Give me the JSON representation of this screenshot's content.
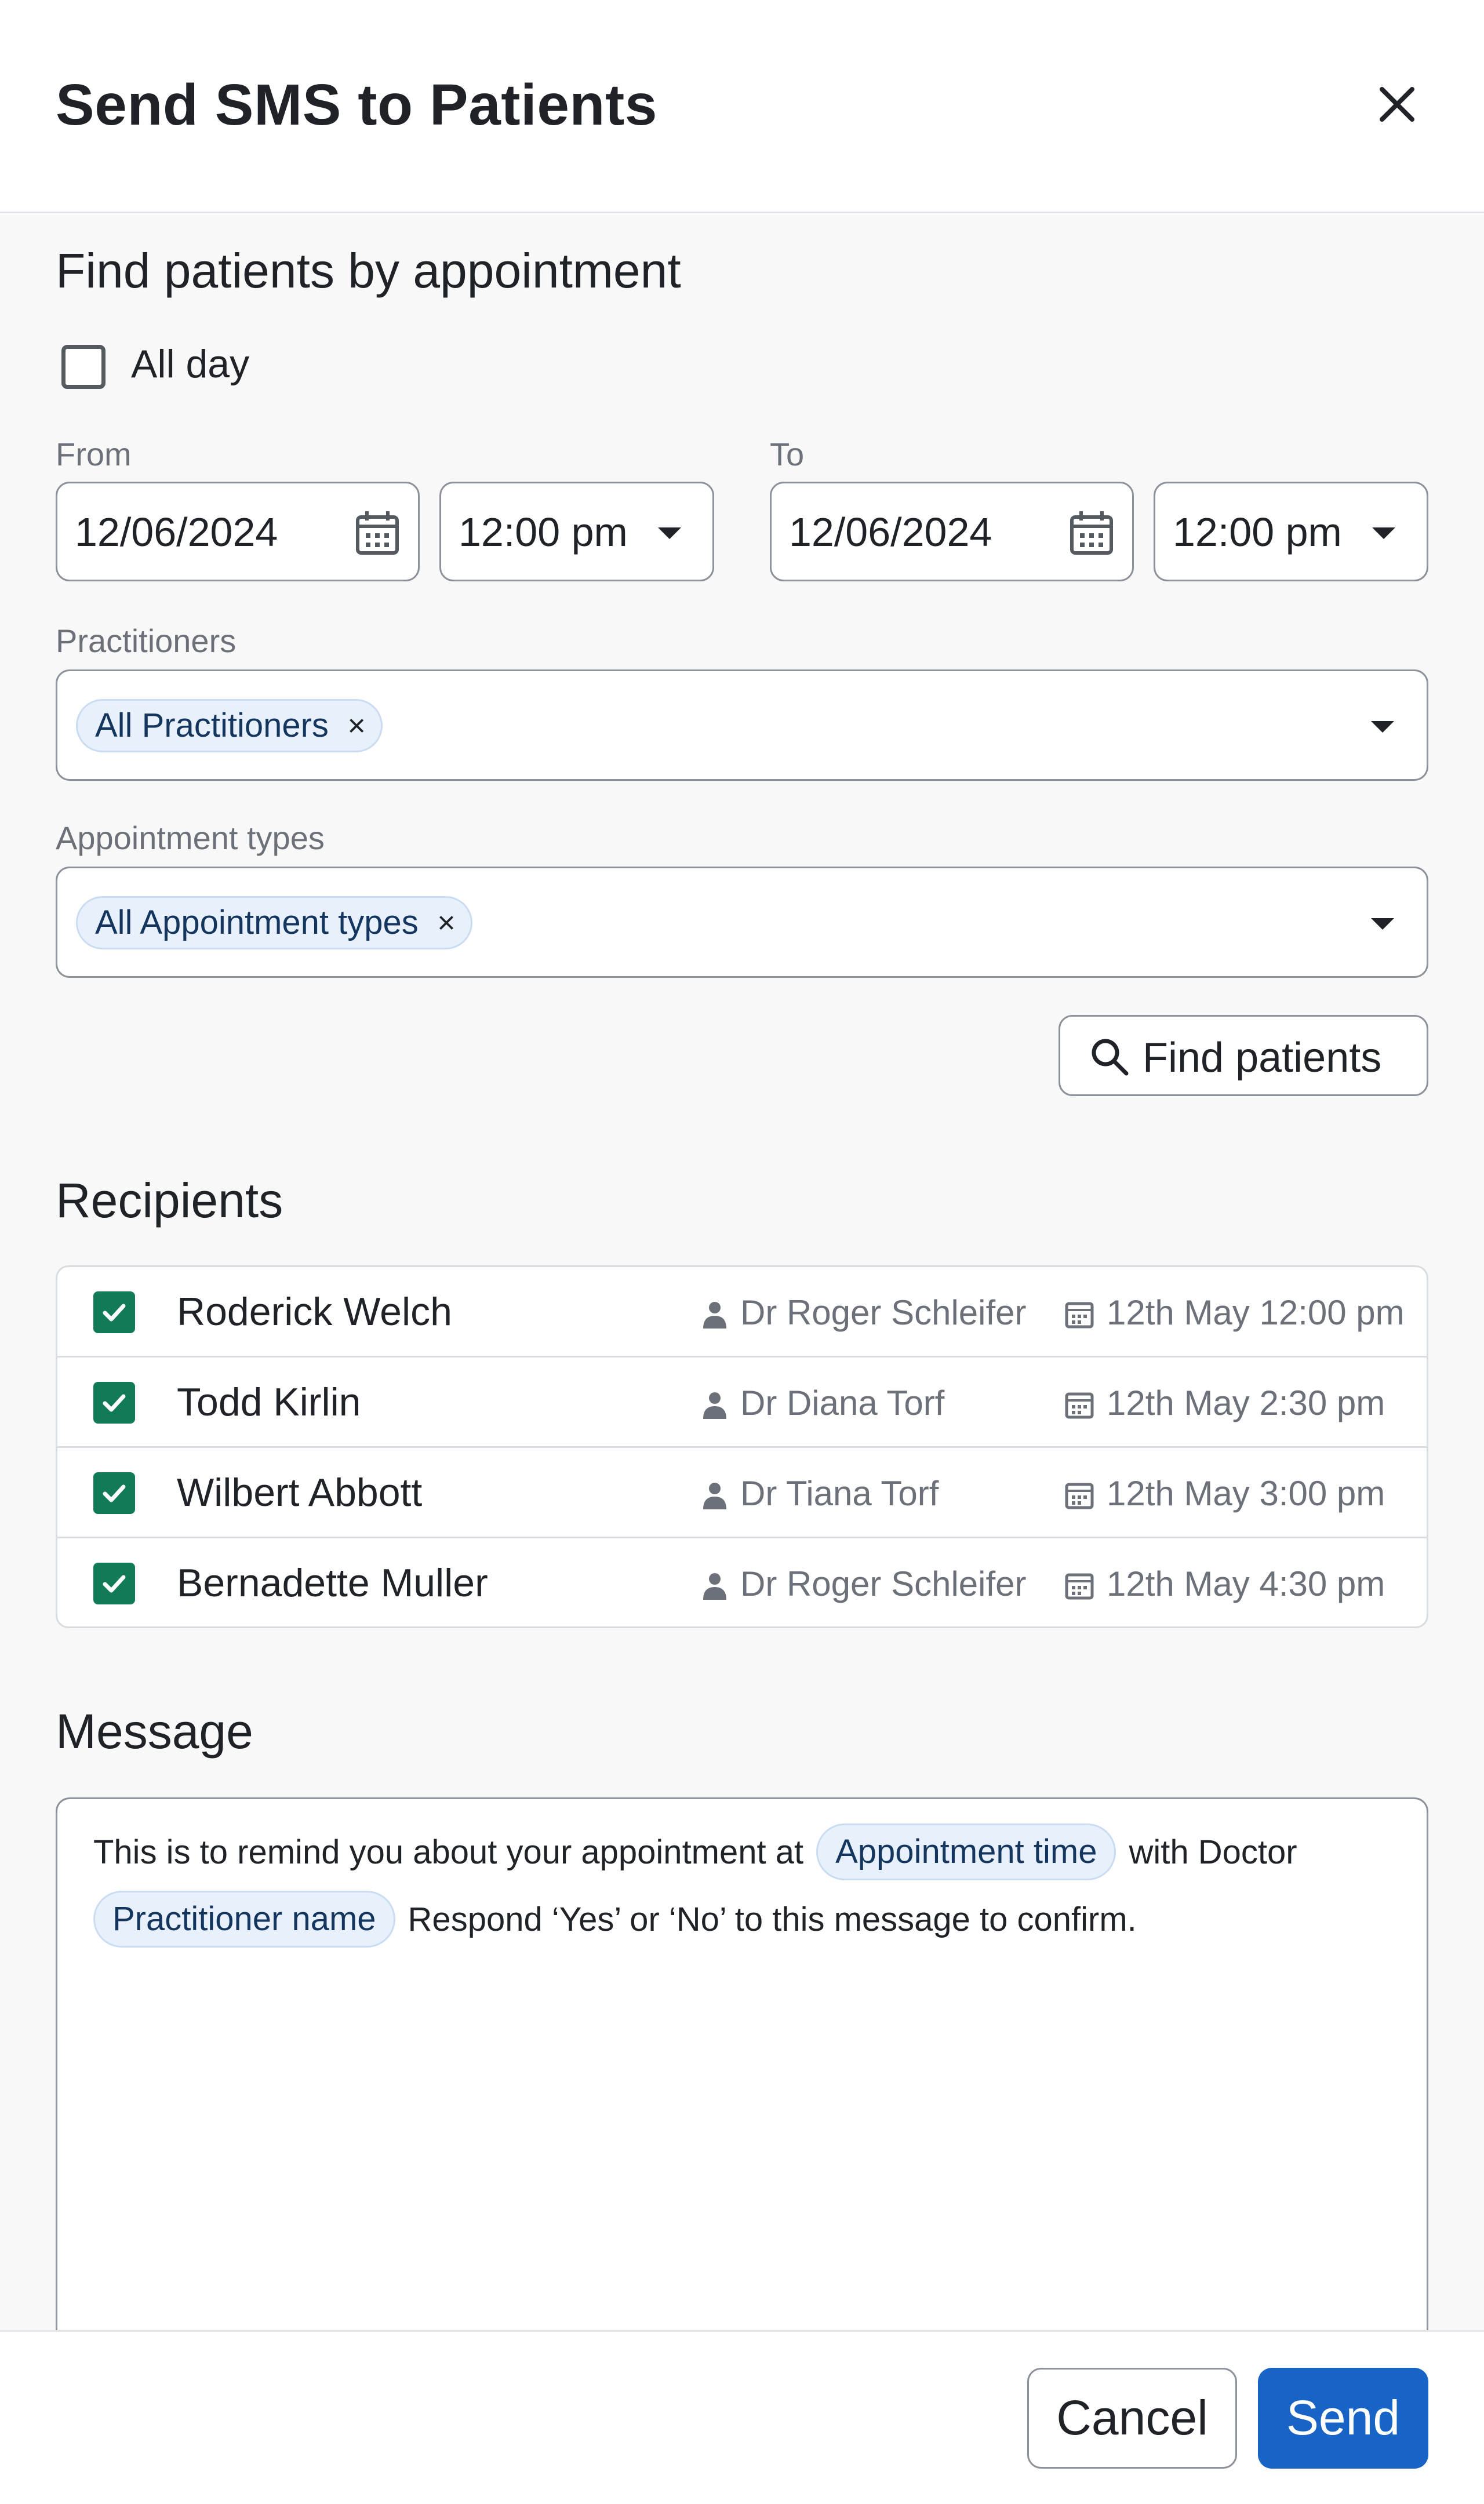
{
  "dialog": {
    "title": "Send SMS to Patients"
  },
  "find_section": {
    "title": "Find patients by appointment",
    "all_day_label": "All day",
    "all_day_checked": false,
    "from_label": "From",
    "to_label": "To",
    "from_date": "12/06/2024",
    "from_time": "12:00 pm",
    "to_date": "12/06/2024",
    "to_time": "12:00 pm",
    "practitioners_label": "Practitioners",
    "practitioners_chip": "All Practitioners",
    "appointment_types_label": "Appointment types",
    "appointment_types_chip": "All Appointment types",
    "find_button": "Find patients",
    "chip_remove_symbol": "×"
  },
  "recipients": {
    "title": "Recipients",
    "rows": [
      {
        "name": "Roderick Welch",
        "practitioner": "Dr Roger Schleifer",
        "time": "12th May 12:00 pm",
        "checked": true
      },
      {
        "name": "Todd Kirlin",
        "practitioner": "Dr Diana Torf",
        "time": "12th May 2:30 pm",
        "checked": true
      },
      {
        "name": "Wilbert Abbott",
        "practitioner": "Dr Tiana Torf",
        "time": "12th May 3:00 pm",
        "checked": true
      },
      {
        "name": "Bernadette Muller",
        "practitioner": "Dr Roger Schleifer",
        "time": "12th May 4:30 pm",
        "checked": true
      }
    ]
  },
  "message": {
    "title": "Message",
    "line1_prefix": "This is to remind you about your appointment at",
    "token_appointment_time": "Appointment time",
    "line1_suffix": "with Doctor",
    "token_practitioner_name": "Practitioner name",
    "line2_suffix": "Respond ‘Yes’ or ‘No’ to this message to confirm."
  },
  "footer": {
    "cancel_label": "Cancel",
    "send_label": "Send"
  },
  "colors": {
    "primary": "#1764c6",
    "check_green": "#117a57",
    "chip_bg": "#e8f1fb"
  },
  "icons": {
    "close": "close-icon",
    "calendar": "calendar-icon",
    "dropdown": "caret-down-icon",
    "search": "search-icon",
    "practitioner": "practitioner-icon",
    "checkmark": "checkmark-icon"
  }
}
